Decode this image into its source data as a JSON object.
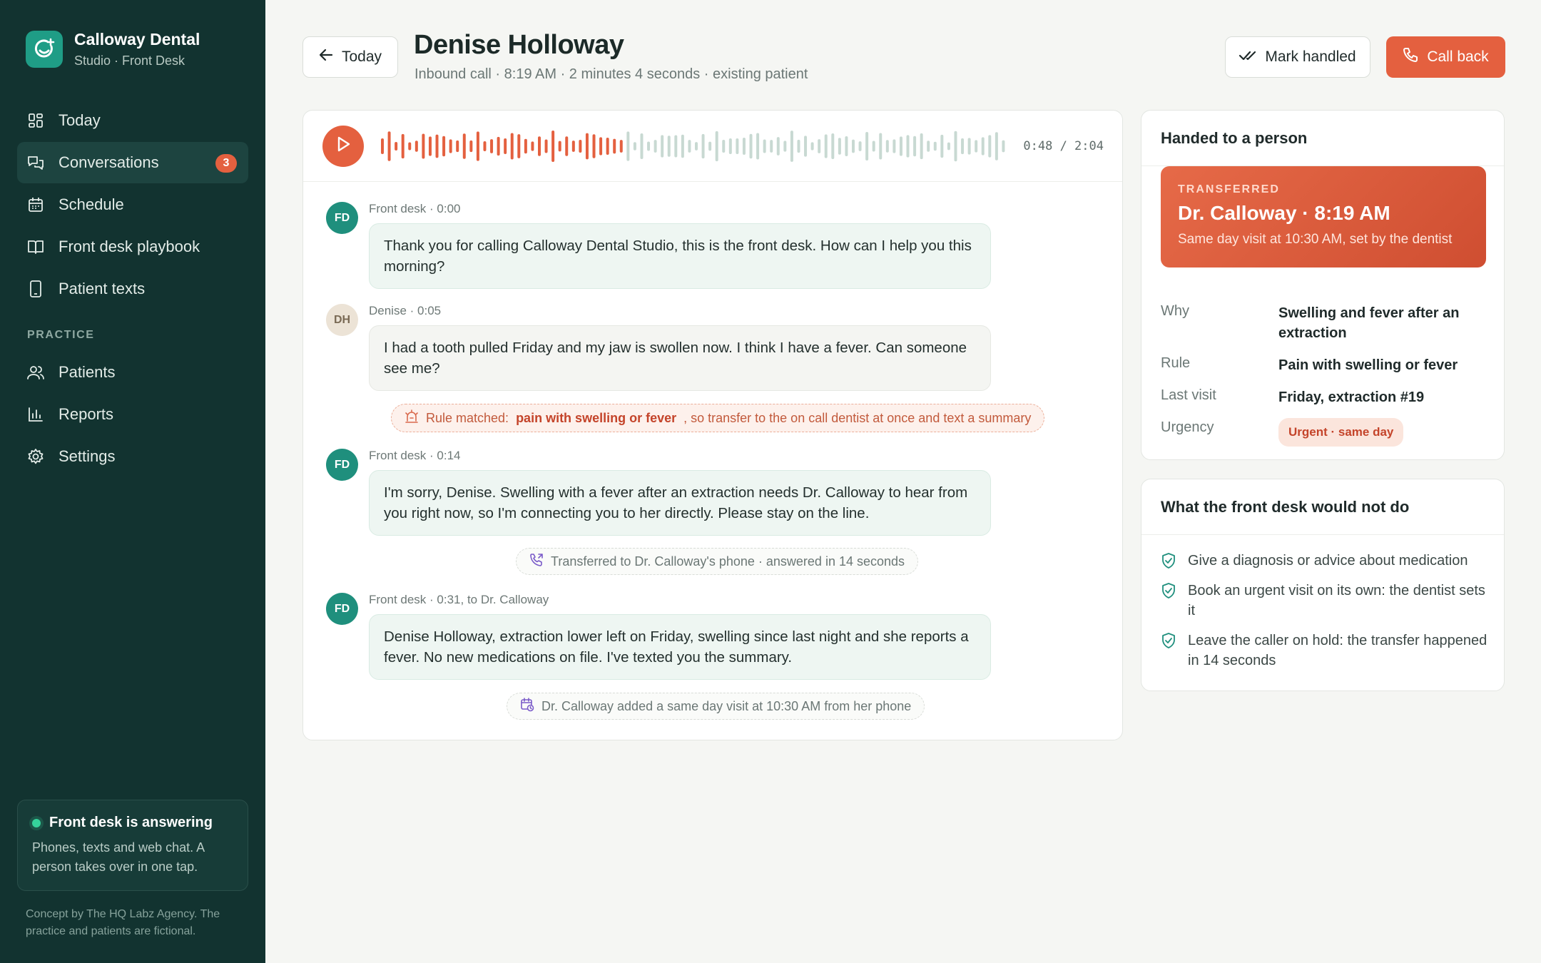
{
  "brand": {
    "name": "Calloway Dental",
    "subtitle": "Studio · Front Desk"
  },
  "nav": {
    "items": [
      {
        "label": "Today",
        "icon": "grid-icon"
      },
      {
        "label": "Conversations",
        "icon": "chat-icon",
        "badge": "3",
        "active": true
      },
      {
        "label": "Schedule",
        "icon": "calendar-icon"
      },
      {
        "label": "Front desk playbook",
        "icon": "book-icon"
      },
      {
        "label": "Patient texts",
        "icon": "phone-device-icon"
      }
    ],
    "section_label": "PRACTICE",
    "practice_items": [
      {
        "label": "Patients",
        "icon": "users-icon"
      },
      {
        "label": "Reports",
        "icon": "bar-chart-icon"
      },
      {
        "label": "Settings",
        "icon": "gear-icon"
      }
    ]
  },
  "status": {
    "title": "Front desk is answering",
    "text": "Phones, texts and web chat. A person takes over in one tap."
  },
  "credit": "Concept by The HQ Labz Agency. The practice and patients are fictional.",
  "header": {
    "back_label": "Today",
    "title": "Denise Holloway",
    "subtitle": "Inbound call · 8:19 AM · 2 minutes 4 seconds · existing patient",
    "mark_label": "Mark handled",
    "call_label": "Call back"
  },
  "player": {
    "time": "0:48 / 2:04",
    "progress": 0.39
  },
  "transcript": {
    "messages": [
      {
        "initials": "FD",
        "meta": "Front desk · 0:00",
        "text": "Thank you for calling Calloway Dental Studio, this is the front desk. How can I help you this morning?"
      },
      {
        "initials": "DH",
        "meta": "Denise · 0:05",
        "text": "I had a tooth pulled Friday and my jaw is swollen now. I think I have a fever. Can someone see me?"
      },
      {
        "initials": "FD",
        "meta": "Front desk · 0:14",
        "text": "I'm sorry, Denise. Swelling with a fever after an extraction needs Dr. Calloway to hear from you right now, so I'm connecting you to her directly. Please stay on the line."
      },
      {
        "initials": "FD",
        "meta": "Front desk · 0:31, to Dr. Calloway",
        "text": "Denise Holloway, extraction lower left on Friday, swelling since last night and she reports a fever. No new medications on file. I've texted you the summary."
      }
    ],
    "rule": {
      "prefix": "Rule matched:",
      "highlight": "pain with swelling or fever",
      "suffix": ", so transfer to the on call dentist at once and text a summary"
    },
    "event_transfer": "Transferred to Dr. Calloway's phone · answered in 14 seconds",
    "event_visit": "Dr. Calloway added a same day visit at 10:30 AM from her phone"
  },
  "handed": {
    "title": "Handed to a person",
    "status_label": "TRANSFERRED",
    "main": "Dr. Calloway · 8:19 AM",
    "sub": "Same day visit at 10:30 AM, set by the dentist",
    "why_label": "Why",
    "why": "Swelling and fever after an extraction",
    "rule_label": "Rule",
    "rule": "Pain with swelling or fever",
    "last_label": "Last visit",
    "last": "Friday, extraction #19",
    "urgency_label": "Urgency",
    "urgency": "Urgent · same day"
  },
  "notdo": {
    "title": "What the front desk would not do",
    "items": [
      "Give a diagnosis or advice about medication",
      "Book an urgent visit on its own: the dentist sets it",
      "Leave the caller on hold: the transfer happened in 14 seconds"
    ]
  },
  "colors": {
    "accent": "#e4603f",
    "sidebar": "#123330",
    "teal": "#1f8f7d",
    "wave_played": "#e4603f",
    "wave_unplayed": "#c8d9d2"
  }
}
